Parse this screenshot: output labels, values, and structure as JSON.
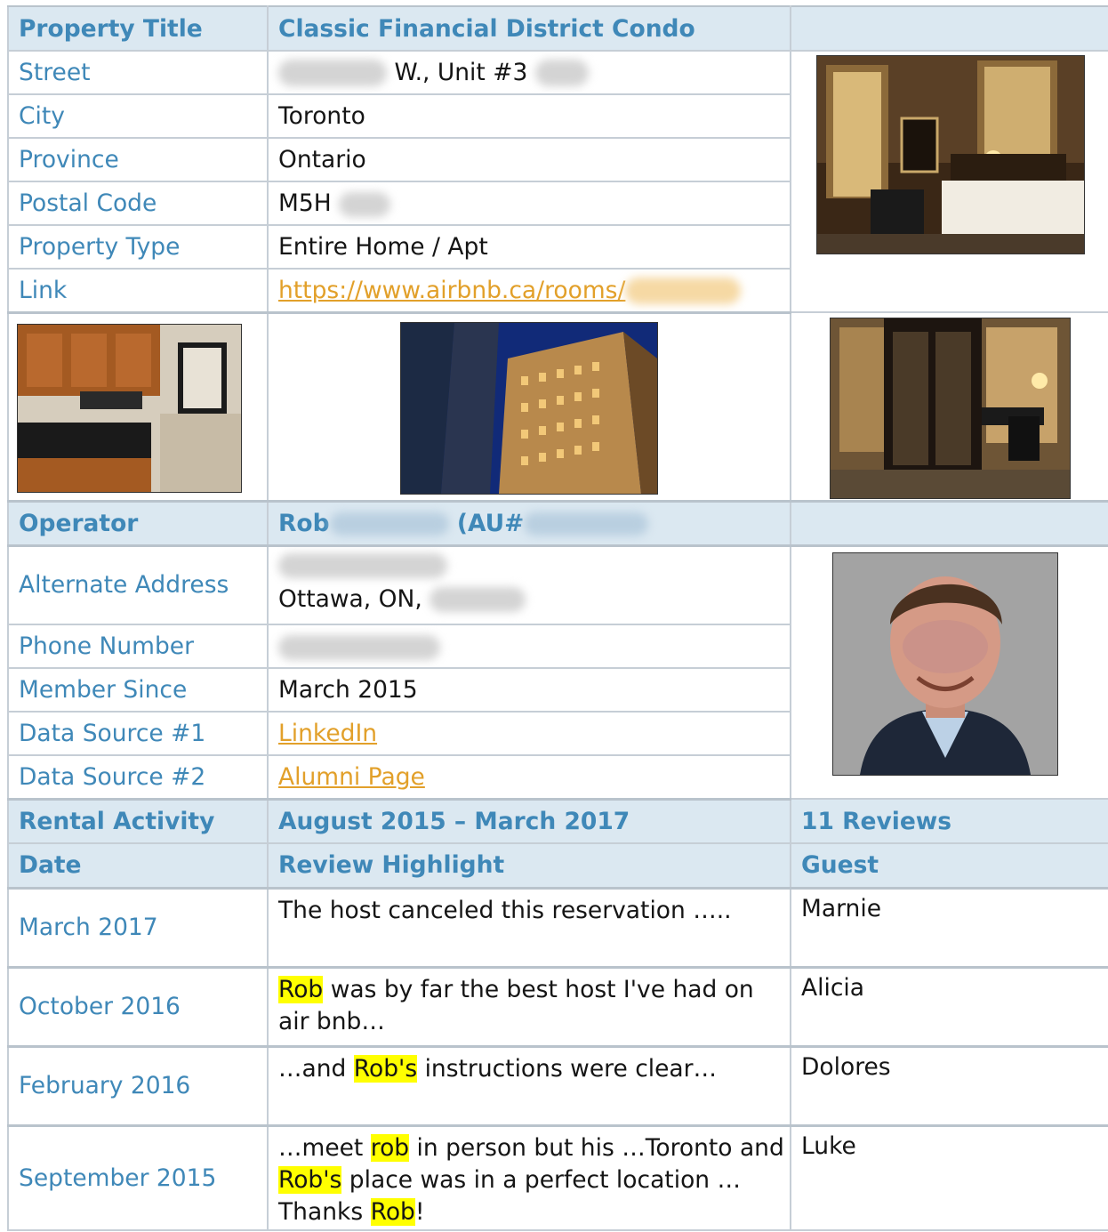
{
  "property": {
    "title_label": "Property Title",
    "title_value": "Classic Financial District Condo",
    "rows": [
      {
        "label": "Street",
        "value": "W., Unit #3"
      },
      {
        "label": "City",
        "value": "Toronto"
      },
      {
        "label": "Province",
        "value": "Ontario"
      },
      {
        "label": "Postal Code",
        "value": "M5H"
      },
      {
        "label": "Property Type",
        "value": "Entire Home / Apt"
      },
      {
        "label": "Link",
        "value": "https://www.airbnb.ca/rooms/"
      }
    ]
  },
  "operator": {
    "label": "Operator",
    "name": "Rob",
    "au_prefix": "(AU#",
    "rows": [
      {
        "label": "Alternate Address",
        "value": "Ottawa, ON,"
      },
      {
        "label": "Phone Number",
        "value": ""
      },
      {
        "label": "Member Since",
        "value": "March 2015"
      },
      {
        "label": "Data Source #1",
        "value": "LinkedIn"
      },
      {
        "label": "Data Source #2",
        "value": "Alumni Page"
      }
    ]
  },
  "activity": {
    "label": "Rental Activity",
    "range": "August 2015 – March 2017",
    "reviews_count": "11 Reviews"
  },
  "reviews_header": {
    "date": "Date",
    "highlight": "Review Highlight",
    "guest": "Guest"
  },
  "reviews": [
    {
      "date": "March 2017",
      "guest": "Marnie",
      "parts": [
        "The host canceled this reservation ….."
      ]
    },
    {
      "date": "October 2016",
      "guest": "Alicia",
      "parts": [
        "Rob",
        " was by far the best host I've had on air bnb…"
      ]
    },
    {
      "date": "February 2016",
      "guest": "Dolores",
      "parts": [
        "…and ",
        "Rob's",
        " instructions were clear…"
      ]
    },
    {
      "date": "September 2015",
      "guest": "Luke",
      "parts": [
        "…meet ",
        "rob",
        " in person but his …Toronto and ",
        "Rob's",
        " place was in a perfect location … Thanks ",
        "Rob",
        "!"
      ]
    }
  ],
  "colors": {
    "header_bg": "#dbe8f1",
    "label_blue": "#3f88b8",
    "link_orange": "#e2a02a",
    "highlight_yellow": "#ffff00"
  },
  "images": [
    {
      "name": "bedroom-photo"
    },
    {
      "name": "kitchen-photo"
    },
    {
      "name": "building-photo"
    },
    {
      "name": "wardrobe-photo"
    },
    {
      "name": "operator-portrait"
    }
  ]
}
